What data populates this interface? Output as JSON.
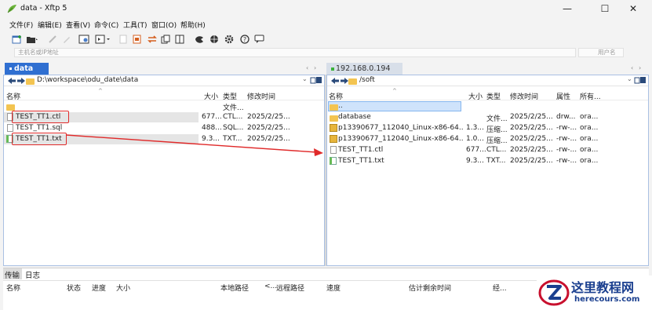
{
  "window": {
    "title": "data - Xftp 5",
    "minimize_glyph": "—",
    "maximize_glyph": "☐",
    "close_glyph": "✕"
  },
  "menu": [
    {
      "label": "文件(F)"
    },
    {
      "label": "编辑(E)"
    },
    {
      "label": "查看(V)"
    },
    {
      "label": "命令(C)"
    },
    {
      "label": "工具(T)"
    },
    {
      "label": "窗口(O)"
    },
    {
      "label": "帮助(H)"
    }
  ],
  "address": {
    "host_placeholder": "主机名或IP地址",
    "user_placeholder": "用户名"
  },
  "left_pane": {
    "tab_label": "data",
    "path": "D:\\workspace\\odu_date\\data",
    "columns": [
      "名称",
      "大小",
      "类型",
      "修改时间"
    ],
    "rows": [
      {
        "name": "",
        "size": "",
        "type": "文件...",
        "modified": "",
        "icon": "folder-icon"
      },
      {
        "name": "TEST_TT1.ctl",
        "size": "677...",
        "type": "CTL...",
        "modified": "2025/2/25...",
        "icon": "file-icon"
      },
      {
        "name": "TEST_TT1.sql",
        "size": "488...",
        "type": "SQL...",
        "modified": "2025/2/25...",
        "icon": "file-icon"
      },
      {
        "name": "TEST_TT1.txt",
        "size": "9.3...",
        "type": "TXT...",
        "modified": "2025/2/25...",
        "icon": "text-file-icon"
      }
    ]
  },
  "right_pane": {
    "tab_label": "192.168.0.194",
    "path": "/soft",
    "columns": [
      "名称",
      "大小",
      "类型",
      "修改时间",
      "属性",
      "所有..."
    ],
    "rows": [
      {
        "name": "..",
        "size": "",
        "type": "",
        "modified": "",
        "attr": "",
        "owner": "",
        "icon": "folder-icon"
      },
      {
        "name": "database",
        "size": "",
        "type": "文件...",
        "modified": "2025/2/25...",
        "attr": "drw...",
        "owner": "ora...",
        "icon": "folder-icon"
      },
      {
        "name": "p13390677_112040_Linux-x86-64...",
        "size": "1.3...",
        "type": "压缩...",
        "modified": "2025/2/25...",
        "attr": "-rw-...",
        "owner": "ora...",
        "icon": "zip-icon"
      },
      {
        "name": "p13390677_112040_Linux-x86-64...",
        "size": "1.0...",
        "type": "压缩...",
        "modified": "2025/2/25...",
        "attr": "-rw-...",
        "owner": "ora...",
        "icon": "zip-icon"
      },
      {
        "name": "TEST_TT1.ctl",
        "size": "677...",
        "type": "CTL...",
        "modified": "2025/2/25...",
        "attr": "-rw-...",
        "owner": "ora...",
        "icon": "file-icon"
      },
      {
        "name": "TEST_TT1.txt",
        "size": "9.3...",
        "type": "TXT...",
        "modified": "2025/2/25...",
        "attr": "-rw-...",
        "owner": "ora...",
        "icon": "text-file-icon"
      }
    ]
  },
  "transfer_panel": {
    "tabs": [
      "传输",
      "日志"
    ],
    "columns": [
      "名称",
      "状态",
      "进度",
      "大小",
      "本地路径",
      "<...",
      "远程路径",
      "速度",
      "估计剩余时间",
      "经..."
    ]
  },
  "watermark": {
    "title": "这里教程网",
    "url": "herecours.com"
  },
  "colors": {
    "annotation_red": "#e02a2a",
    "tab_active_bg": "#2f6fd1",
    "selection_blue": "#cfe3fb",
    "folder": "#f3c451"
  }
}
